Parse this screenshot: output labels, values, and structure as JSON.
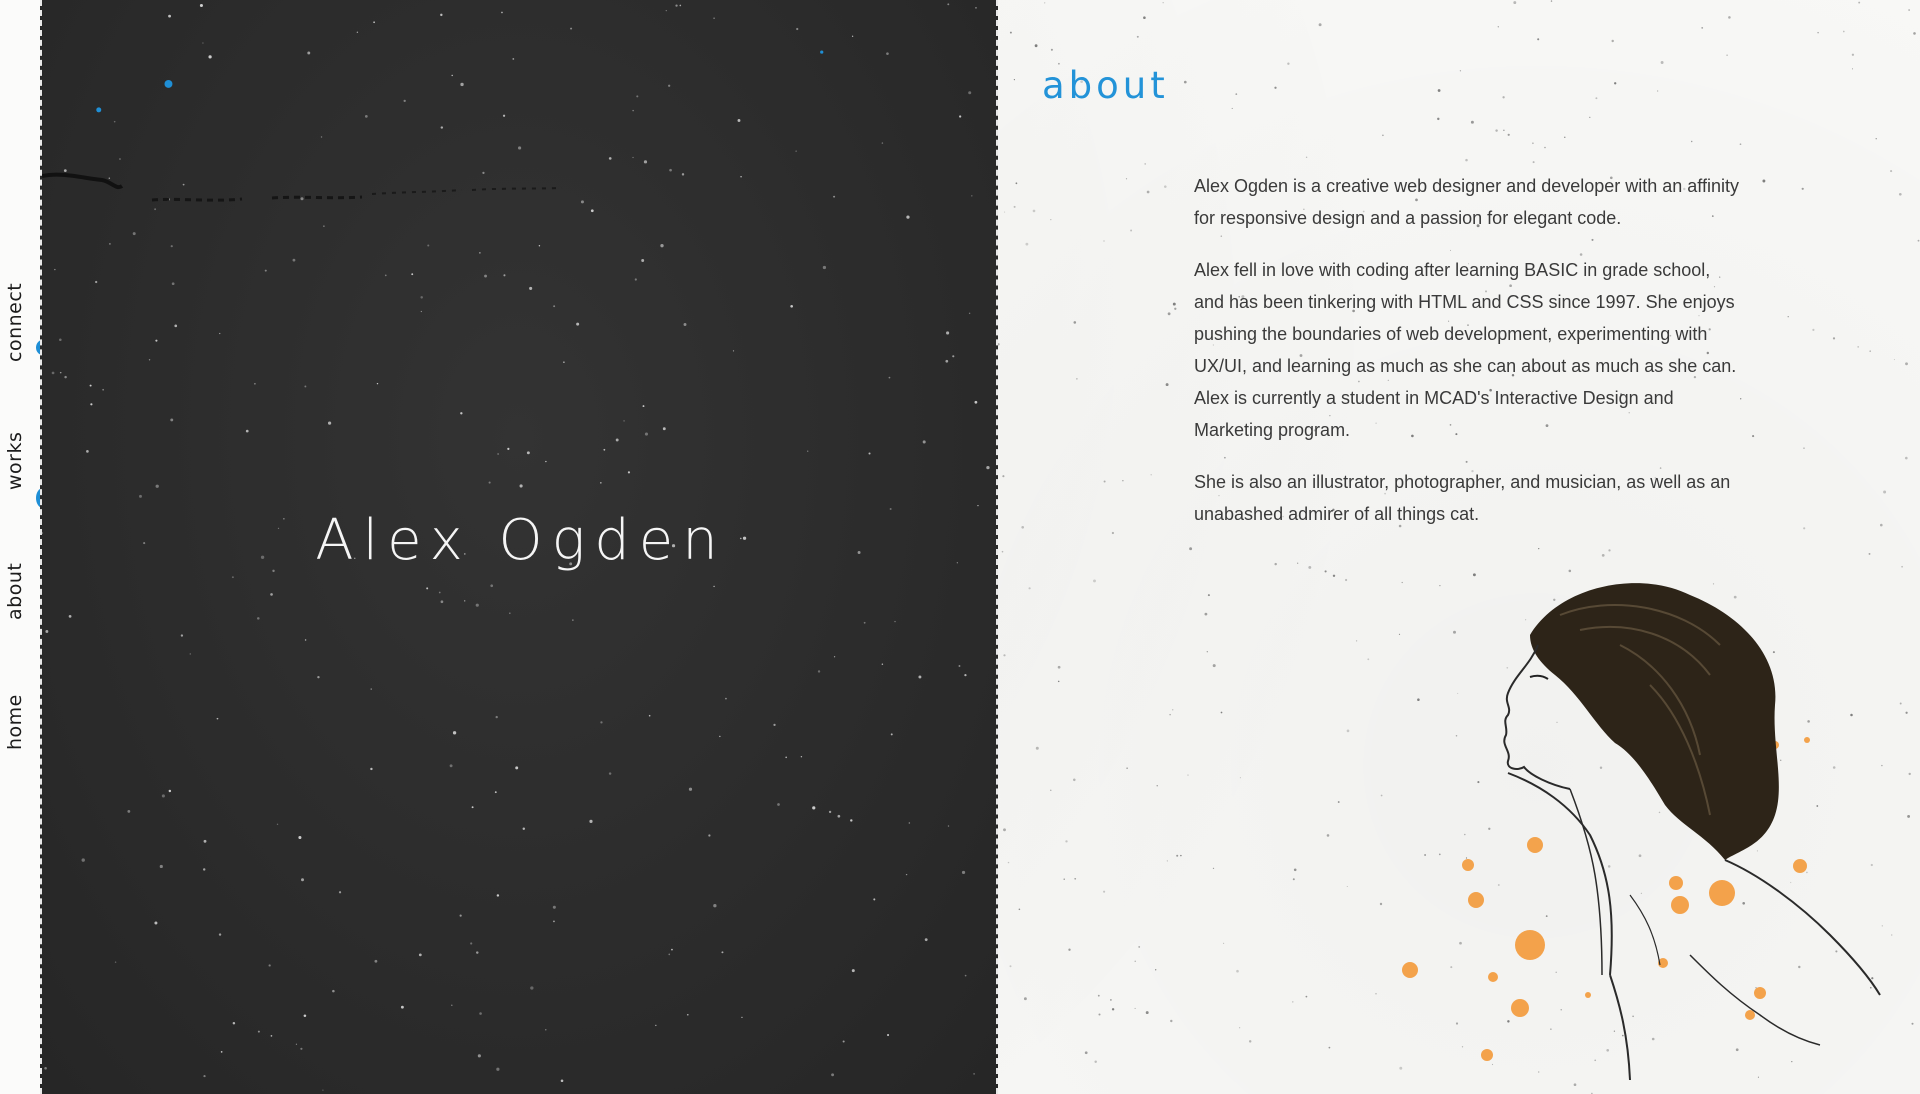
{
  "nav": {
    "items": [
      {
        "label": "home"
      },
      {
        "label": "about"
      },
      {
        "label": "works"
      },
      {
        "label": "connect"
      }
    ]
  },
  "hero": {
    "name": "Alex Ogden"
  },
  "about": {
    "heading": "about",
    "paragraphs": [
      "Alex Ogden is a creative web designer and developer with an affinity for responsive design and a passion for elegant code.",
      "Alex fell in love with coding after learning BASIC in grade school, and has been tinkering with HTML and CSS since 1997. She enjoys pushing the boundaries of web development, experimenting with UX/UI, and learning as much as she can about as much as she can. Alex is currently a student in MCAD's Interactive Design and Marketing program.",
      "She is also an illustrator, photographer, and musician, as well as an unabashed admirer of all things cat."
    ]
  },
  "colors": {
    "accent": "#2393d8",
    "dark_panel": "#2d2d2d",
    "paint_orange": "#f39a3a"
  },
  "icons": {
    "portrait": "portrait-illustration"
  }
}
